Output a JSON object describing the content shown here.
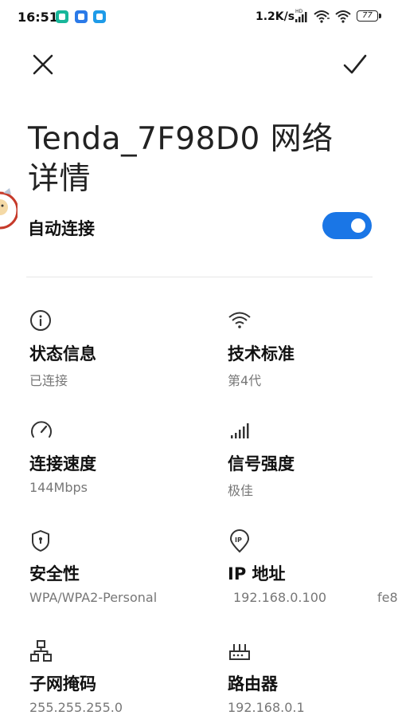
{
  "status_bar": {
    "time": "16:51",
    "net_speed": "1.2K/s",
    "signal_badge": "HD",
    "battery": "77",
    "icons": [
      "app-notification-icon",
      "app-notification-icon",
      "app-notification-icon",
      "cellular-signal-icon",
      "wifi-icon",
      "wifi-icon",
      "battery-icon"
    ]
  },
  "toolbar": {
    "close_icon": "close-icon",
    "confirm_icon": "check-icon"
  },
  "page": {
    "title": "Tenda_7F98D0 网络详情"
  },
  "auto_connect": {
    "label": "自动连接",
    "enabled": true,
    "accent": "#1a76e6"
  },
  "details": [
    {
      "icon": "info-icon",
      "title": "状态信息",
      "value": "已连接"
    },
    {
      "icon": "wifi-standard-icon",
      "title": "技术标准",
      "value": "第4代"
    },
    {
      "icon": "speed-gauge-icon",
      "title": "连接速度",
      "value": "144Mbps"
    },
    {
      "icon": "signal-strength-icon",
      "title": "信号强度",
      "value": "极佳"
    },
    {
      "icon": "shield-icon",
      "title": "安全性",
      "value": "WPA/WPA2-Personal"
    },
    {
      "icon": "ip-pin-icon",
      "title": "IP 地址",
      "value": "192.168.0.100",
      "value_extra": "fe8"
    },
    {
      "icon": "subnet-icon",
      "title": "子网掩码",
      "value": "255.255.255.0"
    },
    {
      "icon": "router-icon",
      "title": "路由器",
      "value": "192.168.0.1"
    }
  ]
}
